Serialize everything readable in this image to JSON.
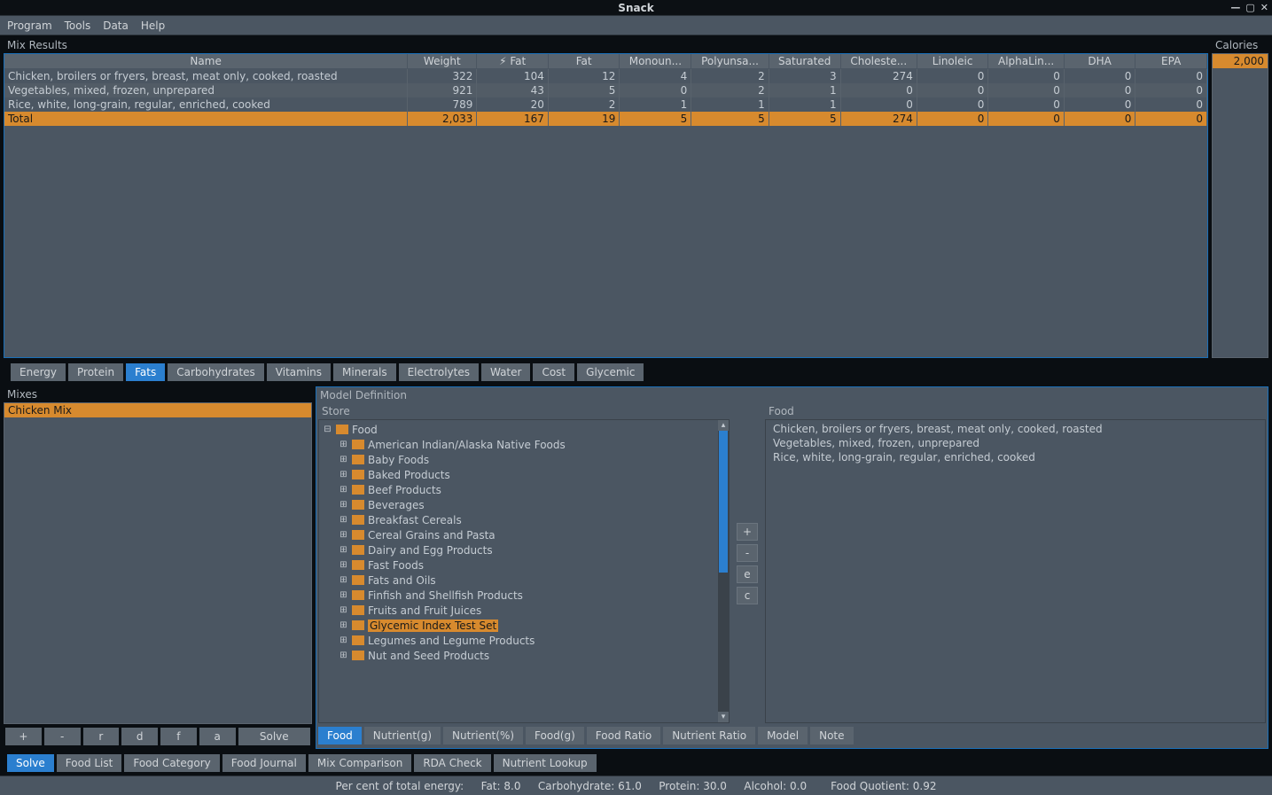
{
  "window": {
    "title": "Snack"
  },
  "menu": [
    "Program",
    "Tools",
    "Data",
    "Help"
  ],
  "mixResults": {
    "label": "Mix Results",
    "columns": [
      "Name",
      "Weight",
      "⚡ Fat",
      "Fat",
      "Monoun...",
      "Polyunsa...",
      "Saturated",
      "Choleste...",
      "Linoleic",
      "AlphaLin...",
      "DHA",
      "EPA"
    ],
    "rows": [
      {
        "name": "Chicken, broilers or fryers, breast, meat only, cooked, roasted",
        "cells": [
          "322",
          "104",
          "12",
          "4",
          "2",
          "3",
          "274",
          "0",
          "0",
          "0",
          "0"
        ]
      },
      {
        "name": "Vegetables, mixed, frozen, unprepared",
        "cells": [
          "921",
          "43",
          "5",
          "0",
          "2",
          "1",
          "0",
          "0",
          "0",
          "0",
          "0"
        ]
      },
      {
        "name": "Rice, white, long-grain, regular, enriched, cooked",
        "cells": [
          "789",
          "20",
          "2",
          "1",
          "1",
          "1",
          "0",
          "0",
          "0",
          "0",
          "0"
        ]
      }
    ],
    "total": {
      "name": "Total",
      "cells": [
        "2,033",
        "167",
        "19",
        "5",
        "5",
        "5",
        "274",
        "0",
        "0",
        "0",
        "0"
      ]
    }
  },
  "calories": {
    "label": "Calories",
    "value": "2,000"
  },
  "nutrientTabs": [
    "Energy",
    "Protein",
    "Fats",
    "Carbohydrates",
    "Vitamins",
    "Minerals",
    "Electrolytes",
    "Water",
    "Cost",
    "Glycemic"
  ],
  "nutrientTabActive": 2,
  "mixes": {
    "label": "Mixes",
    "items": [
      "Chicken Mix"
    ],
    "selected": 0,
    "buttons": [
      "+",
      "-",
      "r",
      "d",
      "f",
      "a",
      "Solve"
    ]
  },
  "modelDef": {
    "label": "Model Definition",
    "storeLabel": "Store",
    "tree": {
      "root": "Food",
      "children": [
        "American Indian/Alaska Native Foods",
        "Baby Foods",
        "Baked Products",
        "Beef Products",
        "Beverages",
        "Breakfast Cereals",
        "Cereal Grains and Pasta",
        "Dairy and Egg Products",
        "Fast Foods",
        "Fats and Oils",
        "Finfish and Shellfish Products",
        "Fruits and Fruit Juices",
        "Glycemic Index Test Set",
        "Legumes and Legume Products",
        "Nut and Seed Products"
      ],
      "selected": 12
    },
    "sideButtons": [
      "+",
      "-",
      "e",
      "c"
    ],
    "foodLabel": "Food",
    "foodItems": [
      "Chicken, broilers or fryers, breast, meat only, cooked, roasted",
      "Vegetables, mixed, frozen, unprepared",
      "Rice, white, long-grain, regular, enriched, cooked"
    ]
  },
  "modelTabs": [
    "Food",
    "Nutrient(g)",
    "Nutrient(%)",
    "Food(g)",
    "Food Ratio",
    "Nutrient Ratio",
    "Model",
    "Note"
  ],
  "modelTabActive": 0,
  "bottomTabs": [
    "Solve",
    "Food List",
    "Food Category",
    "Food Journal",
    "Mix Comparison",
    "RDA Check",
    "Nutrient Lookup"
  ],
  "bottomTabActive": 0,
  "status": {
    "label": "Per cent of total energy:",
    "fat": "Fat: 8.0",
    "carb": "Carbohydrate: 61.0",
    "protein": "Protein: 30.0",
    "alcohol": "Alcohol: 0.0",
    "fq": "Food Quotient: 0.92"
  }
}
